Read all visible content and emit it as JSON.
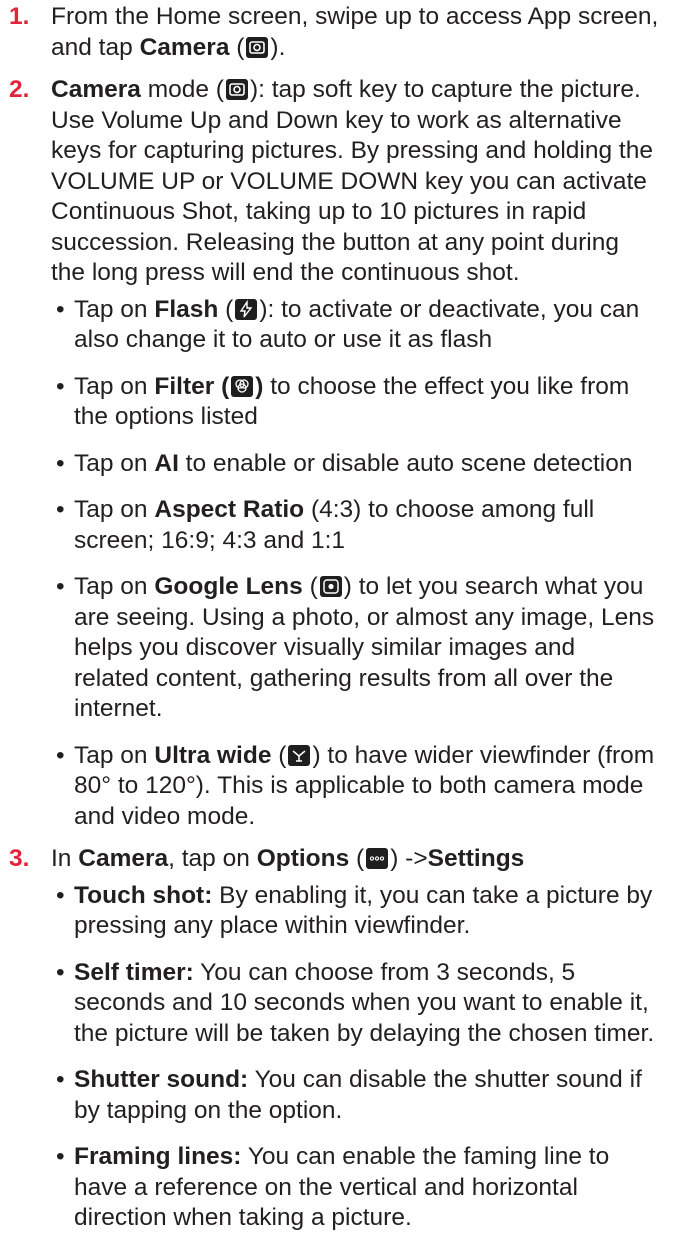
{
  "colors": {
    "accent": "#e0243a",
    "text": "#231f20",
    "icon_bg": "#1e1e1e"
  },
  "steps": [
    {
      "num": "1.",
      "parts": [
        "From the Home screen, swipe up to access App screen, and tap ",
        "Camera",
        " (",
        ")."
      ]
    },
    {
      "num": "2.",
      "parts": [
        "Camera",
        " mode (",
        "): tap soft key to capture the picture. Use Volume Up and Down key to work as alternative keys for capturing pictures. By pressing and holding the VOLUME UP or VOLUME DOWN key you can activate Continuous Shot, taking up to 10 pictures in rapid succession. Releasing the button at any point during the long press will end the continuous shot."
      ],
      "bullets": [
        {
          "parts": [
            "Tap on ",
            "Flash",
            " (",
            "): to activate or deactivate, you can also change it to auto or use it as flash"
          ]
        },
        {
          "parts": [
            "Tap on ",
            "Filter  (",
            ")",
            " to choose the effect you like from the options listed"
          ]
        },
        {
          "parts": [
            "Tap on ",
            "AI",
            " to enable or disable auto scene detection"
          ]
        },
        {
          "parts": [
            "Tap on ",
            "Aspect Ratio",
            " (4:3) to choose among full screen; 16:9; 4:3 and 1:1"
          ]
        },
        {
          "parts": [
            "Tap on ",
            "Google Lens",
            " (",
            ") to let you search what you are seeing. Using a photo, or almost any image, Lens helps you discover visually similar images and related content, gathering results from all over the internet."
          ]
        },
        {
          "parts": [
            "Tap on ",
            "Ultra wide",
            " (",
            ") to have wider viewfinder (from 80° to 120°). This is applicable to both camera mode and video mode."
          ]
        }
      ]
    },
    {
      "num": "3.",
      "parts": [
        "In ",
        "Camera",
        ", tap on ",
        "Options",
        " (",
        ") ->",
        "Settings"
      ],
      "bullets": [
        {
          "parts": [
            "Touch shot:",
            " By enabling it, you can take a picture by pressing any place within viewfinder."
          ]
        },
        {
          "parts": [
            "Self timer:",
            " You can choose from 3 seconds, 5 seconds and 10 seconds when you want to enable it, the picture will be taken by delaying the chosen timer."
          ]
        },
        {
          "parts": [
            "Shutter sound:",
            " You can disable the shutter sound if by tapping on the option."
          ]
        },
        {
          "parts": [
            "Framing lines:",
            " You can enable the faming line to have a reference on the vertical and horizontal direction when taking a picture."
          ]
        }
      ]
    }
  ],
  "bullet_char": "•"
}
